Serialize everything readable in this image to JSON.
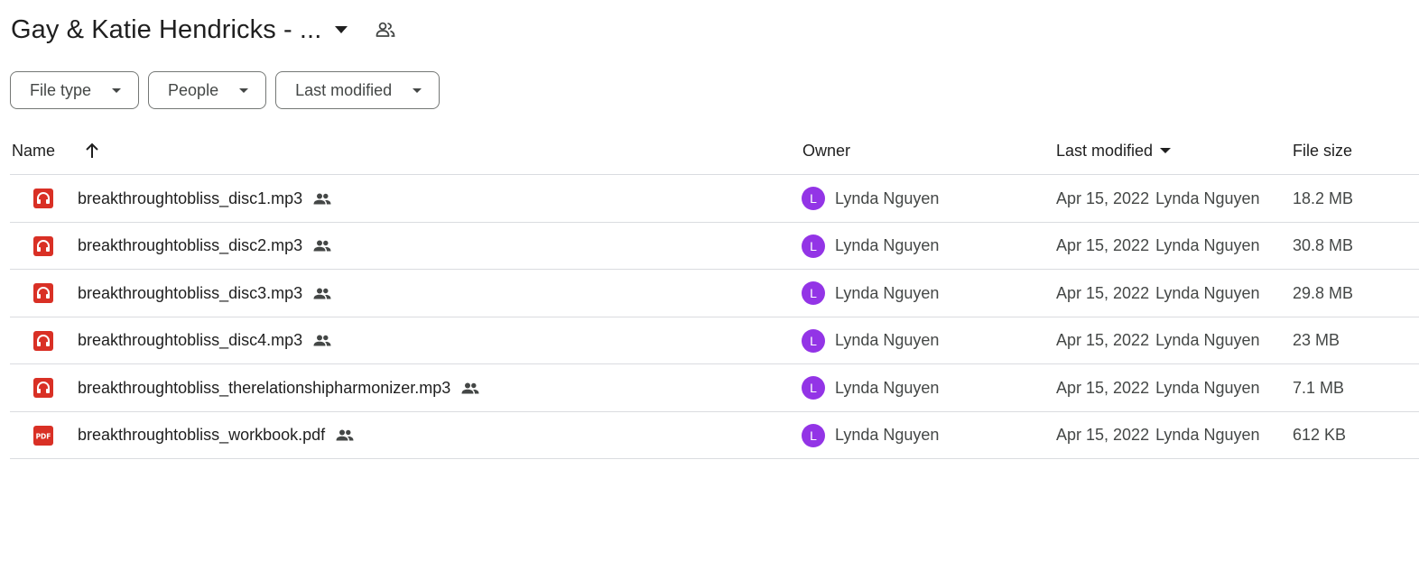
{
  "header": {
    "title": "Gay & Katie Hendricks - ...",
    "caret_icon": "arrow-drop-down-icon",
    "shared_icon": "shared-folder-people-icon"
  },
  "filters": [
    {
      "label": "File type"
    },
    {
      "label": "People"
    },
    {
      "label": "Last modified"
    }
  ],
  "columns": {
    "name": "Name",
    "owner": "Owner",
    "last_modified": "Last modified",
    "file_size": "File size"
  },
  "files": [
    {
      "name": "breakthroughtobliss_disc1.mp3",
      "type": "audio",
      "owner": "Lynda Nguyen",
      "owner_initial": "L",
      "modified": "Apr 15, 2022",
      "modified_by": "Lynda Nguyen",
      "size": "18.2 MB"
    },
    {
      "name": "breakthroughtobliss_disc2.mp3",
      "type": "audio",
      "owner": "Lynda Nguyen",
      "owner_initial": "L",
      "modified": "Apr 15, 2022",
      "modified_by": "Lynda Nguyen",
      "size": "30.8 MB"
    },
    {
      "name": "breakthroughtobliss_disc3.mp3",
      "type": "audio",
      "owner": "Lynda Nguyen",
      "owner_initial": "L",
      "modified": "Apr 15, 2022",
      "modified_by": "Lynda Nguyen",
      "size": "29.8 MB"
    },
    {
      "name": "breakthroughtobliss_disc4.mp3",
      "type": "audio",
      "owner": "Lynda Nguyen",
      "owner_initial": "L",
      "modified": "Apr 15, 2022",
      "modified_by": "Lynda Nguyen",
      "size": "23 MB"
    },
    {
      "name": "breakthroughtobliss_therelationshipharmonizer.mp3",
      "type": "audio",
      "owner": "Lynda Nguyen",
      "owner_initial": "L",
      "modified": "Apr 15, 2022",
      "modified_by": "Lynda Nguyen",
      "size": "7.1 MB"
    },
    {
      "name": "breakthroughtobliss_workbook.pdf",
      "type": "pdf",
      "pdf_label": "PDF",
      "owner": "Lynda Nguyen",
      "owner_initial": "L",
      "modified": "Apr 15, 2022",
      "modified_by": "Lynda Nguyen",
      "size": "612 KB"
    }
  ],
  "colors": {
    "file_icon_red": "#d93025",
    "avatar_purple": "#9334e6",
    "divider": "#dadce0",
    "chip_border": "#747775"
  }
}
